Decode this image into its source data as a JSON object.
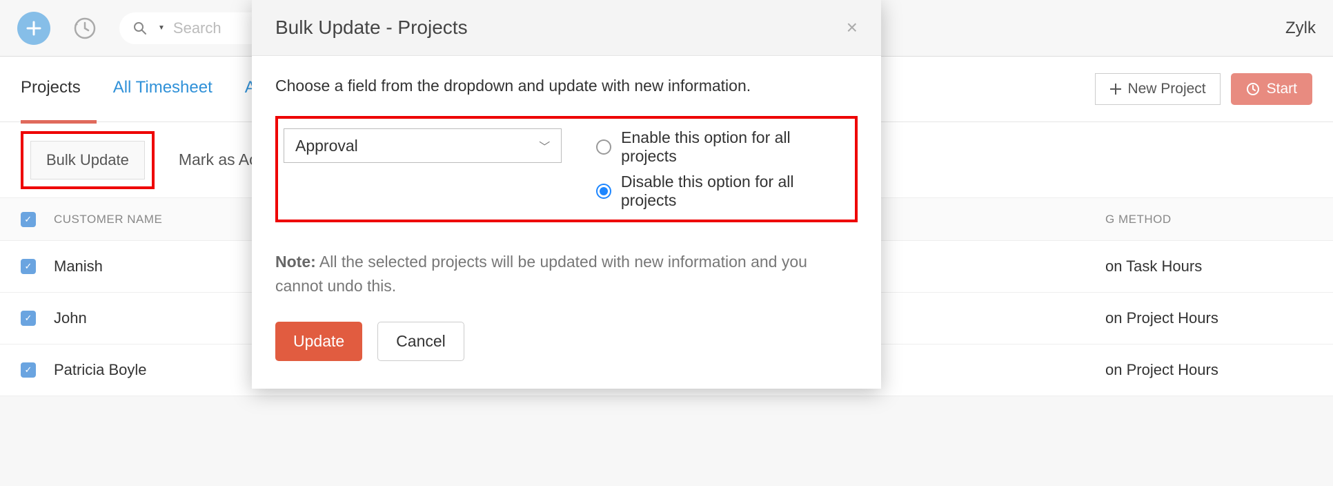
{
  "topbar": {
    "search_placeholder": "Search",
    "brand": "Zylk"
  },
  "tabs": {
    "projects": "Projects",
    "all_timesheet": "All Timesheet",
    "cutoff": "A"
  },
  "tab_actions": {
    "new_project": "New Project",
    "start": "Start"
  },
  "actions": {
    "bulk_update": "Bulk Update",
    "mark_active": "Mark as Active"
  },
  "table": {
    "header_customer": "CUSTOMER NAME",
    "header_method": "G METHOD",
    "rows": [
      {
        "customer": "Manish",
        "method": "on Task Hours"
      },
      {
        "customer": "John",
        "method": "on Project Hours"
      },
      {
        "customer": "Patricia Boyle",
        "method": "on Project Hours"
      }
    ]
  },
  "modal": {
    "title": "Bulk Update - Projects",
    "description": "Choose a field from the dropdown and update with new information.",
    "field_selected": "Approval",
    "radio_enable": "Enable this option for all projects",
    "radio_disable": "Disable this option for all projects",
    "note_label": "Note:",
    "note_text": "All the selected projects will be updated with new information and you cannot undo this.",
    "update": "Update",
    "cancel": "Cancel"
  }
}
